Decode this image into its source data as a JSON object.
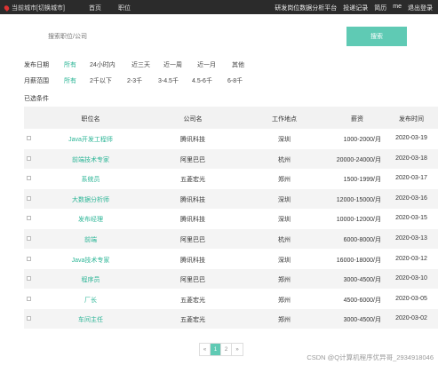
{
  "topbar": {
    "location": "当前城市[切换城市]",
    "nav": [
      "首页",
      "职位"
    ],
    "right": [
      "研发岗位数据分析平台",
      "投递记录",
      "简历",
      "me",
      "退出登录"
    ]
  },
  "search": {
    "placeholder": "搜索职位/公司",
    "button": "搜索"
  },
  "filters": {
    "date": {
      "label": "发布日期",
      "options": [
        "所有",
        "24小时内",
        "近三天",
        "近一周",
        "近一月",
        "其他"
      ],
      "active_index": 0
    },
    "salary": {
      "label": "月薪范围",
      "options": [
        "所有",
        "2千以下",
        "2-3千",
        "3-4.5千",
        "4.5-6千",
        "6-8千"
      ],
      "active_index": 0
    },
    "selected_label": "已选条件"
  },
  "table": {
    "headers": [
      "职位名",
      "公司名",
      "工作地点",
      "薪资",
      "发布时间"
    ],
    "rows": [
      {
        "job": "Java开发工程师",
        "company": "腾讯科技",
        "location": "深圳",
        "salary": "1000-2000/月",
        "date": "2020-03-19"
      },
      {
        "job": "前端技术专家",
        "company": "阿里巴巴",
        "location": "杭州",
        "salary": "20000-24000/月",
        "date": "2020-03-18"
      },
      {
        "job": "系统员",
        "company": "五菱宏光",
        "location": "郑州",
        "salary": "1500-1999/月",
        "date": "2020-03-17"
      },
      {
        "job": "大数据分析师",
        "company": "腾讯科技",
        "location": "深圳",
        "salary": "12000-15000/月",
        "date": "2020-03-16"
      },
      {
        "job": "发布经理",
        "company": "腾讯科技",
        "location": "深圳",
        "salary": "10000-12000/月",
        "date": "2020-03-15"
      },
      {
        "job": "前端",
        "company": "阿里巴巴",
        "location": "杭州",
        "salary": "6000-8000/月",
        "date": "2020-03-13"
      },
      {
        "job": "Java技术专家",
        "company": "腾讯科技",
        "location": "深圳",
        "salary": "16000-18000/月",
        "date": "2020-03-12"
      },
      {
        "job": "程序员",
        "company": "阿里巴巴",
        "location": "郑州",
        "salary": "3000-4500/月",
        "date": "2020-03-10"
      },
      {
        "job": "厂长",
        "company": "五菱宏光",
        "location": "郑州",
        "salary": "4500-6000/月",
        "date": "2020-03-05"
      },
      {
        "job": "车间主任",
        "company": "五菱宏光",
        "location": "郑州",
        "salary": "3000-4500/月",
        "date": "2020-03-02"
      }
    ]
  },
  "pagination": {
    "prev": "«",
    "pages": [
      "1",
      "2"
    ],
    "next": "»",
    "current": "1"
  },
  "watermark": "CSDN @Q计算机程序优异哥_2934918046",
  "colors": {
    "accent": "#5fcab4",
    "link": "#2bb596",
    "topbar": "#2b2b2b"
  }
}
